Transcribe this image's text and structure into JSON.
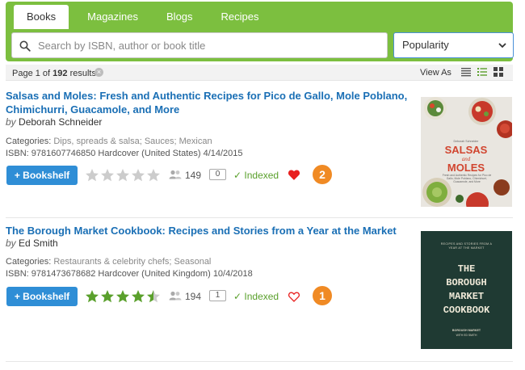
{
  "tabs": [
    "Books",
    "Magazines",
    "Blogs",
    "Recipes"
  ],
  "search": {
    "placeholder": "Search by ISBN, author or book title",
    "value": ""
  },
  "sort": {
    "selected": "Popularity"
  },
  "results": {
    "page_prefix": "Page 1 of ",
    "total": "192",
    "suffix": " results",
    "clear_glyph": "×",
    "view_as_label": "View As"
  },
  "books": [
    {
      "title": "Salsas and Moles: Fresh and Authentic Recipes for Pico de Gallo, Mole Poblano, Chimichurri, Guacamole, and More",
      "by": "by",
      "author": "Deborah Schneider",
      "categories_label": "Categories:",
      "categories": "Dips, spreads & salsa; Sauces; Mexican",
      "isbn": "ISBN: 9781607746850 Hardcover (United States) 4/14/2015",
      "button_label": "+ Bookshelf",
      "rating": 0,
      "readers": "149",
      "reviews": "0",
      "indexed": "✓ Indexed",
      "favorited": true,
      "badge": "2",
      "cover": {
        "subtitle": "Deborah Schneider",
        "title_line1": "SALSAS",
        "title_line2": "and",
        "title_line3": "MOLES",
        "tagline": "Fresh and Authentic Recipes for Pico de Gallo, Mole Poblano, Chimichurri, Guacamole, and More"
      }
    },
    {
      "title": "The Borough Market Cookbook: Recipes and Stories from a Year at the Market",
      "by": "by",
      "author": "Ed Smith",
      "categories_label": "Categories:",
      "categories": "Restaurants & celebrity chefs; Seasonal",
      "isbn": "ISBN: 9781473678682 Hardcover (United Kingdom) 10/4/2018",
      "button_label": "+ Bookshelf",
      "rating": 4.5,
      "readers": "194",
      "reviews": "1",
      "indexed": "✓ Indexed",
      "favorited": false,
      "badge": "1",
      "cover": {
        "tagline": "RECIPES AND STORIES FROM A YEAR AT THE MARKET",
        "line1": "THE",
        "line2": "BOROUGH",
        "line3": "MARKET",
        "line4": "COOKBOOK",
        "publisher": "BOROUGH MARKET",
        "author": "WITH ED SMITH"
      }
    }
  ],
  "colors": {
    "green": "#7cbf3f",
    "blue_link": "#1a6fb5",
    "button_blue": "#2f8ed6",
    "star_on": "#5aa02c",
    "star_off": "#cccccc",
    "heart_red": "#e8201f",
    "badge_orange": "#f08a24",
    "cover2_bg": "#1f3a33"
  }
}
